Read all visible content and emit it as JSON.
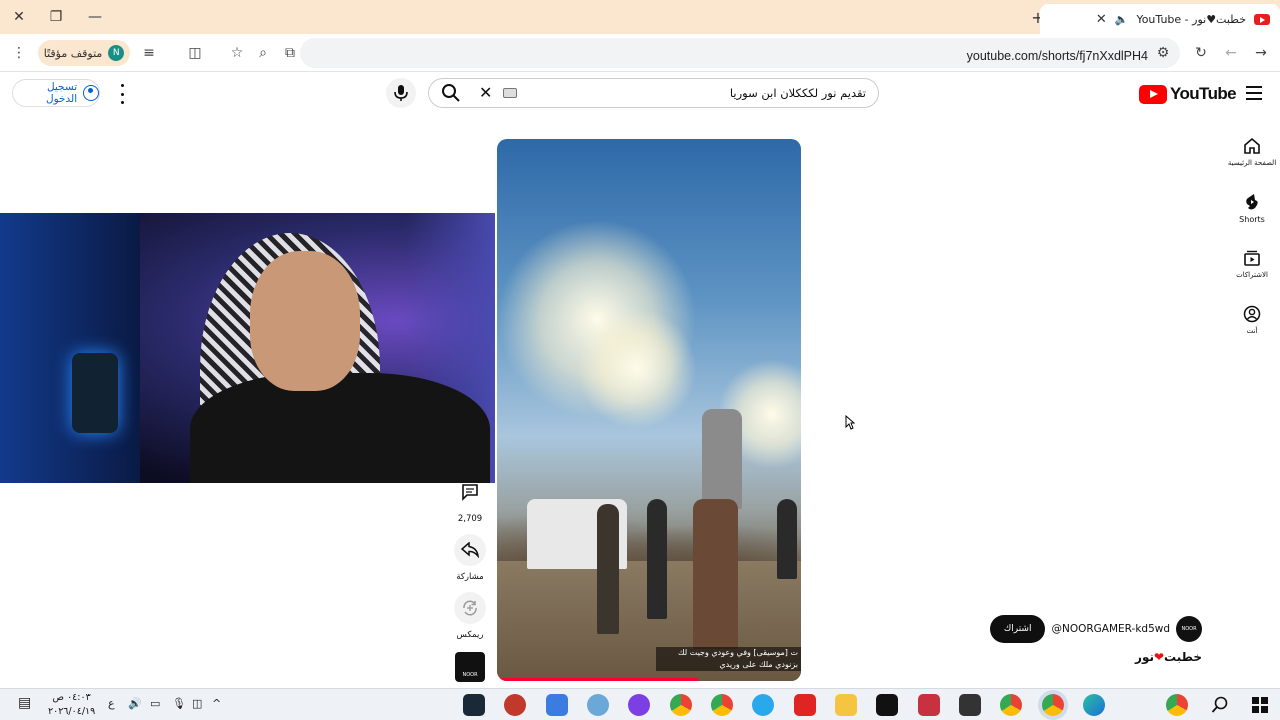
{
  "browser": {
    "tab_title": "خطبت♥نور - YouTube",
    "url": "youtube.com/shorts/fj7nXxdlPH4",
    "paused_label": "متوقف مؤقتًا",
    "profile_initial": "N"
  },
  "youtube": {
    "logo_text": "YouTube",
    "search_query": "تقديم نور لكككلان ابن سوريا",
    "signin_label": "تسجيل الدخول",
    "guide": [
      {
        "label": "الصفحة الرئيسية",
        "icon": "home-icon"
      },
      {
        "label": "Shorts",
        "icon": "shorts-icon"
      },
      {
        "label": "الاشتراكات",
        "icon": "subscriptions-icon"
      },
      {
        "label": "أنت",
        "icon": "you-icon"
      }
    ]
  },
  "short": {
    "caption": "ت [موسيقى] وفي وعودي وجيت لك بزنودي ملك على وريدي",
    "comments_count": "2,709",
    "share_label": "مشاركة",
    "remix_label": "ريمكس",
    "sound_thumb_text": "NOOR",
    "channel_handle": "@NOORGAMER-kd5wd",
    "subscribe_label": "اشتراك",
    "title_prefix": "خطبت",
    "title_suffix": "نور",
    "heart": "❤",
    "avatar_text": "NOOR",
    "progress_fraction": 0.66
  },
  "taskbar": {
    "time": "٠٤:٠٣ ص",
    "date": "٢٠٢٦/٠٤/١٩",
    "lang": "ع"
  }
}
